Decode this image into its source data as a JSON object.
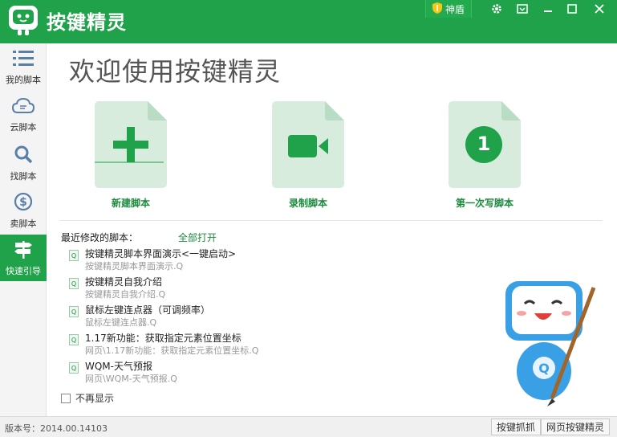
{
  "app": {
    "title": "按键精灵",
    "shield_label": "神盾"
  },
  "sidebar": {
    "items": [
      {
        "label": "我的脚本",
        "icon": "list-icon"
      },
      {
        "label": "云脚本",
        "icon": "cloud-icon"
      },
      {
        "label": "找脚本",
        "icon": "search-icon"
      },
      {
        "label": "卖脚本",
        "icon": "dollar-icon"
      },
      {
        "label": "快速引导",
        "icon": "signpost-icon"
      }
    ]
  },
  "main": {
    "welcome": "欢迎使用按键精灵",
    "cards": [
      {
        "label": "新建脚本",
        "icon": "plus-icon"
      },
      {
        "label": "录制脚本",
        "icon": "video-camera-icon"
      },
      {
        "label": "第一次写脚本",
        "icon": "number-one-icon",
        "number": "1"
      }
    ],
    "recent_header": "最近修改的脚本：",
    "open_all": "全部打开",
    "file_icon_letter": "Q",
    "recent": [
      {
        "name": "按键精灵脚本界面演示<一键启动>",
        "path": "按键精灵脚本界面演示.Q"
      },
      {
        "name": "按键精灵自我介绍",
        "path": "按键精灵自我介绍.Q"
      },
      {
        "name": "鼠标左键连点器（可调频率）",
        "path": "鼠标左键连点器.Q"
      },
      {
        "name": "1.17新功能：获取指定元素位置坐标",
        "path": "网页\\1.17新功能：获取指定元素位置坐标.Q"
      },
      {
        "name": "WQM-天气预报",
        "path": "网页\\WQM-天气预报.Q"
      }
    ],
    "no_show": "不再显示"
  },
  "status": {
    "version": "版本号：2014.00.14103",
    "btn_capture": "按键抓抓",
    "btn_web": "网页按键精灵"
  },
  "colors": {
    "brand_green": "#1fa24a",
    "card_bg": "#d7ecdd",
    "label_green": "#1a8a3c"
  }
}
